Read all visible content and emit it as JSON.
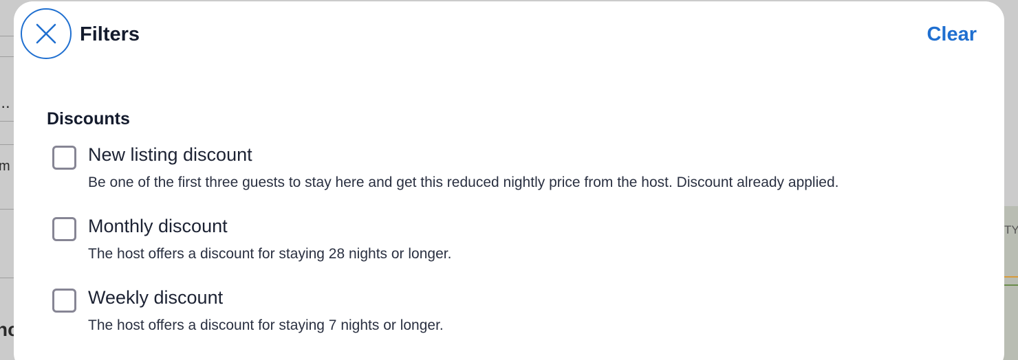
{
  "header": {
    "title": "Filters",
    "clear_label": "Clear"
  },
  "colors": {
    "accent": "#1f6fd0",
    "text_primary": "#141b2d",
    "checkbox_border": "#868594"
  },
  "background": {
    "fragment_1": "i..",
    "fragment_2": "m",
    "fragment_3": "nc",
    "fragment_4": "TY"
  },
  "discounts": {
    "title": "Discounts",
    "options": [
      {
        "label": "New listing discount",
        "description": "Be one of the first three guests to stay here and get this reduced nightly price from the host. Discount already applied.",
        "checked": false
      },
      {
        "label": "Monthly discount",
        "description": "The host offers a discount for staying 28 nights or longer.",
        "checked": false
      },
      {
        "label": "Weekly discount",
        "description": "The host offers a discount for staying 7 nights or longer.",
        "checked": false
      }
    ]
  }
}
